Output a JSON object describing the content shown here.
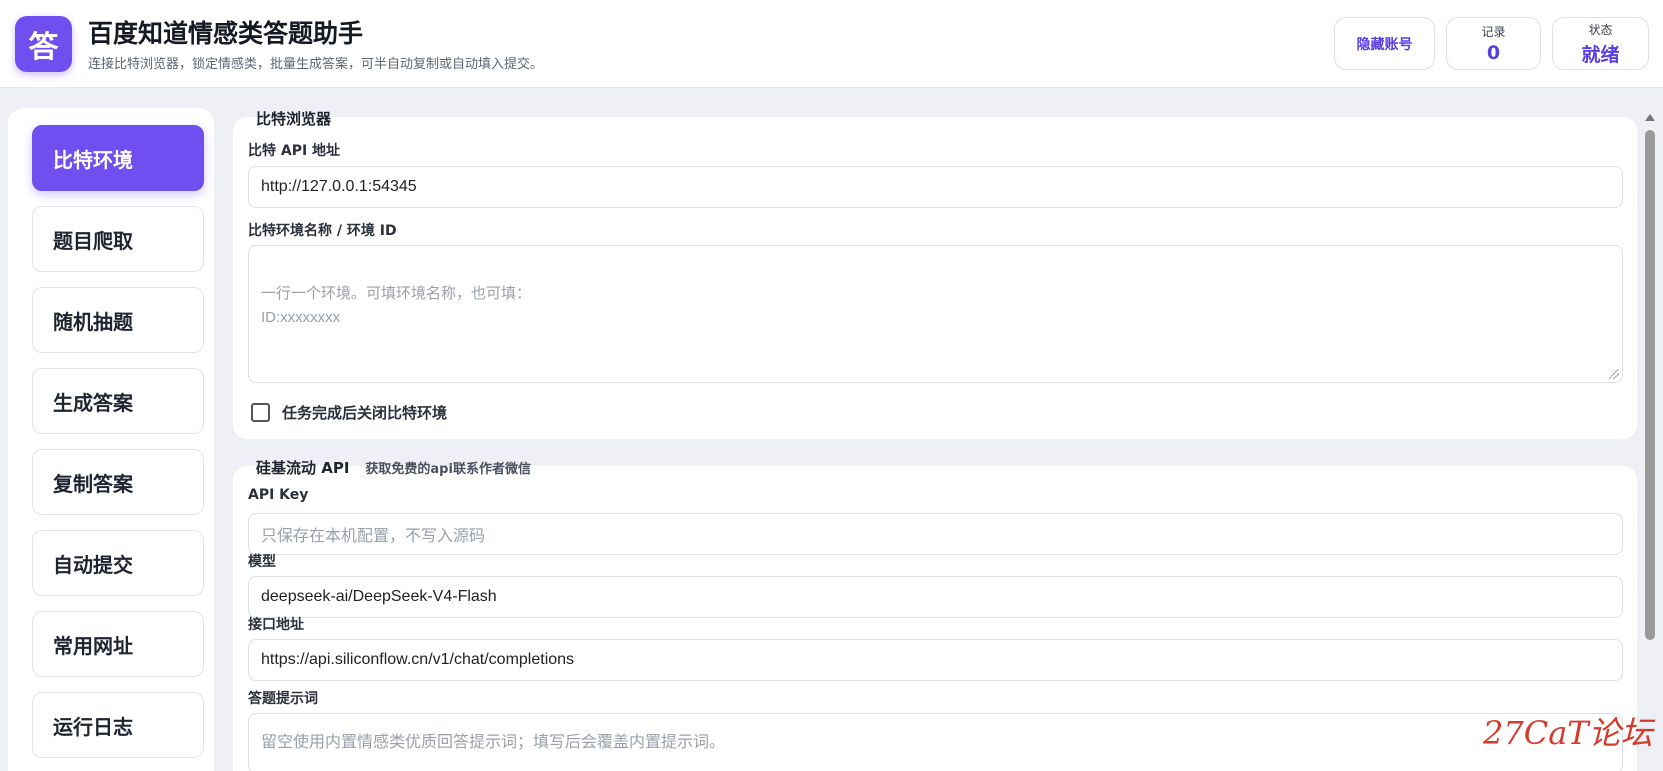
{
  "header": {
    "logo_char": "答",
    "title": "百度知道情感类答题助手",
    "subtitle": "连接比特浏览器，锁定情感类，批量生成答案，可半自动复制或自动填入提交。",
    "hide_account_label": "隐藏账号",
    "records_label": "记录",
    "records_value": "0",
    "status_label": "状态",
    "status_value": "就绪"
  },
  "sidebar": {
    "items": [
      {
        "label": "比特环境",
        "active": true
      },
      {
        "label": "题目爬取"
      },
      {
        "label": "随机抽题"
      },
      {
        "label": "生成答案"
      },
      {
        "label": "复制答案"
      },
      {
        "label": "自动提交"
      },
      {
        "label": "常用网址"
      },
      {
        "label": "运行日志"
      }
    ]
  },
  "bit_panel": {
    "title": "比特浏览器",
    "api_label": "比特 API 地址",
    "api_value": "http://127.0.0.1:54345",
    "env_label": "比特环境名称 / 环境 ID",
    "env_placeholder": "一行一个环境。可填环境名称，也可填：\nID:xxxxxxxx",
    "close_checkbox_label": "任务完成后关闭比特环境",
    "close_checkbox_checked": false
  },
  "api_panel": {
    "title": "硅基流动 API",
    "note": "获取免费的api联系作者微信",
    "key_label": "API Key",
    "key_placeholder": "只保存在本机配置，不写入源码",
    "model_label": "模型",
    "model_value": "deepseek-ai/DeepSeek-V4-Flash",
    "endpoint_label": "接口地址",
    "endpoint_value": "https://api.siliconflow.cn/v1/chat/completions",
    "prompt_label": "答题提示词",
    "prompt_placeholder": "留空使用内置情感类优质回答提示词；填写后会覆盖内置提示词。"
  },
  "watermark": "27CaT论坛",
  "colors": {
    "accent": "#6f4ff0",
    "background": "#eef0f5",
    "panel": "#ffffff"
  }
}
